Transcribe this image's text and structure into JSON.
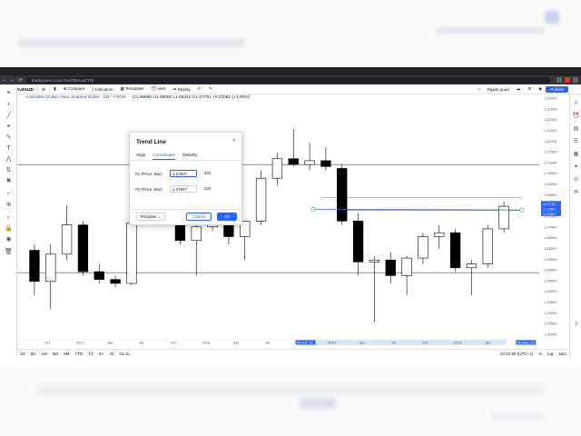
{
  "browser": {
    "url": "tradingview.com/chart/ZBAoxE7D/",
    "nav": [
      "←",
      "→",
      "⟳"
    ]
  },
  "toolbar": {
    "symbol": "AUDNZD",
    "interval": "W",
    "compare": "Compare",
    "indicators": "Indicators",
    "templates": "Templates",
    "alert": "Alert",
    "replay": "Replay",
    "layout_name": "Ripple quad",
    "publish": "Publish"
  },
  "legend": {
    "title": "Australian Dollar / New Zealand Dollar · 1W · FXCM",
    "ohlc": "O1.06690  H1.08090  L1.06310  C1.07761  +0.01062 (+1.00%)"
  },
  "dialog": {
    "title": "Trend Line",
    "tabs": [
      "Style",
      "Coordinates",
      "Visibility"
    ],
    "active_tab": "Coordinates",
    "row1": {
      "label": "#1 (Price, Bar)",
      "price": "1.07607",
      "bar": "201"
    },
    "row2": {
      "label": "#2 (Price, Bar)",
      "price": "1.07567",
      "bar": "222"
    },
    "template": "Template",
    "cancel": "Cancel",
    "ok": "Ok"
  },
  "bottom_bar": {
    "ranges": [
      "1D",
      "5D",
      "1M",
      "3M",
      "6M",
      "YTD",
      "1Y",
      "5Y",
      "All"
    ],
    "goto": "Go to...",
    "time": "22:51:59 (UTC+1)",
    "pct": "%",
    "log": "log",
    "auto": "auto"
  },
  "chart_data": {
    "type": "candlestick",
    "x_ticks": [
      "Oct",
      "2017",
      "Apr",
      "Jul",
      "Oct",
      "2018",
      "Apr",
      "Jul",
      "05 Oct '18",
      "2019",
      "Apr",
      "Jul",
      "Oct",
      "2020",
      "Apr",
      "08 May '20"
    ],
    "y_ticks": [
      "1.13000",
      "1.12500",
      "1.12000",
      "1.11500",
      "1.11000",
      "1.10500",
      "1.10000",
      "1.09500",
      "1.09000",
      "1.08500",
      "1.08000",
      "1.07500",
      "1.07000",
      "1.06500",
      "1.06000",
      "1.05500",
      "1.05000",
      "1.04500",
      "1.04000",
      "1.03500",
      "1.03000",
      "1.02500",
      "1.02000"
    ],
    "current_price_labels": [
      "1.07761",
      "1.07607",
      "1.07567"
    ],
    "candles": [
      {
        "o": 1.055,
        "h": 1.058,
        "l": 1.032,
        "c": 1.039
      },
      {
        "o": 1.039,
        "h": 1.058,
        "l": 1.025,
        "c": 1.053
      },
      {
        "o": 1.053,
        "h": 1.078,
        "l": 1.05,
        "c": 1.068
      },
      {
        "o": 1.068,
        "h": 1.07,
        "l": 1.042,
        "c": 1.044
      },
      {
        "o": 1.044,
        "h": 1.048,
        "l": 1.038,
        "c": 1.04
      },
      {
        "o": 1.04,
        "h": 1.042,
        "l": 1.036,
        "c": 1.038
      },
      {
        "o": 1.038,
        "h": 1.07,
        "l": 1.037,
        "c": 1.069
      },
      {
        "o": 1.069,
        "h": 1.1,
        "l": 1.068,
        "c": 1.098
      },
      {
        "o": 1.098,
        "h": 1.103,
        "l": 1.096,
        "c": 1.101
      },
      {
        "o": 1.101,
        "h": 1.11,
        "l": 1.058,
        "c": 1.06
      },
      {
        "o": 1.06,
        "h": 1.068,
        "l": 1.042,
        "c": 1.067
      },
      {
        "o": 1.067,
        "h": 1.09,
        "l": 1.065,
        "c": 1.088
      },
      {
        "o": 1.076,
        "h": 1.084,
        "l": 1.058,
        "c": 1.062
      },
      {
        "o": 1.062,
        "h": 1.07,
        "l": 1.05,
        "c": 1.07
      },
      {
        "o": 1.07,
        "h": 1.096,
        "l": 1.068,
        "c": 1.092
      },
      {
        "o": 1.092,
        "h": 1.105,
        "l": 1.088,
        "c": 1.102
      },
      {
        "o": 1.102,
        "h": 1.117,
        "l": 1.098,
        "c": 1.099
      },
      {
        "o": 1.099,
        "h": 1.11,
        "l": 1.096,
        "c": 1.101
      },
      {
        "o": 1.101,
        "h": 1.108,
        "l": 1.096,
        "c": 1.098
      },
      {
        "o": 1.097,
        "h": 1.099,
        "l": 1.068,
        "c": 1.07
      },
      {
        "o": 1.07,
        "h": 1.074,
        "l": 1.042,
        "c": 1.049
      },
      {
        "o": 1.049,
        "h": 1.052,
        "l": 1.018,
        "c": 1.05
      },
      {
        "o": 1.05,
        "h": 1.054,
        "l": 1.038,
        "c": 1.042
      },
      {
        "o": 1.042,
        "h": 1.052,
        "l": 1.032,
        "c": 1.051
      },
      {
        "o": 1.051,
        "h": 1.064,
        "l": 1.048,
        "c": 1.062
      },
      {
        "o": 1.062,
        "h": 1.068,
        "l": 1.056,
        "c": 1.064
      },
      {
        "o": 1.064,
        "h": 1.066,
        "l": 1.044,
        "c": 1.046
      },
      {
        "o": 1.046,
        "h": 1.05,
        "l": 1.032,
        "c": 1.048
      },
      {
        "o": 1.048,
        "h": 1.068,
        "l": 1.046,
        "c": 1.066
      },
      {
        "o": 1.066,
        "h": 1.08,
        "l": 1.064,
        "c": 1.0776
      }
    ],
    "hlines": [
      1.099,
      1.082,
      1.0755,
      1.0435
    ],
    "trend_line": {
      "p1": 1.07607,
      "p2": 1.07567
    }
  }
}
